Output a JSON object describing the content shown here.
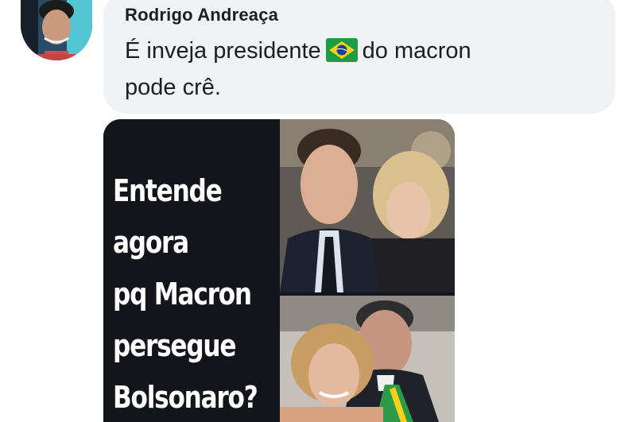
{
  "comment": {
    "author": "Rodrigo Andreaça",
    "line1_before_flag": "É inveja presidente",
    "flag_icon": "brazil-flag-icon",
    "line1_after_flag": "do macron",
    "line2": "pode crê."
  },
  "meme": {
    "text_lines": [
      "Entende",
      "agora",
      "pq Macron",
      "persegue",
      "Bolsonaro?"
    ]
  },
  "colors": {
    "bubble": "#f0f2f5",
    "meme_background": "#13151b",
    "brazil_green": "#1f9a45",
    "brazil_yellow": "#f6d21b",
    "brazil_blue": "#1d3f8f"
  }
}
